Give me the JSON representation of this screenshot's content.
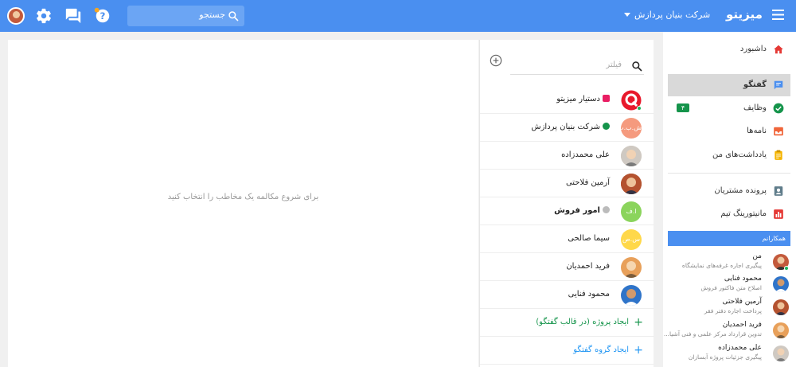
{
  "topbar": {
    "brand": "میزیتو",
    "company": "شرکت بنیان پردازش",
    "search_placeholder": "جستجو"
  },
  "sidebar": {
    "items": [
      {
        "label": "داشبورد",
        "icon": "home-icon",
        "color": "#e53935"
      },
      {
        "label": "گفتگو",
        "icon": "chat-icon",
        "color": "#4a8ff0",
        "active": true
      },
      {
        "label": "وظایف",
        "icon": "check-circle-icon",
        "color": "#15944b",
        "badge": "۴"
      },
      {
        "label": "نامه‌ها",
        "icon": "inbox-icon",
        "color": "#f0653a"
      },
      {
        "label": "یادداشت‌های من",
        "icon": "clipboard-icon",
        "color": "#f5b400"
      },
      {
        "label": "پرونده مشتریان",
        "icon": "contact-icon",
        "color": "#607d8b"
      },
      {
        "label": "مانیتورینگ تیم",
        "icon": "bar-chart-icon",
        "color": "#e53935"
      }
    ],
    "colleagues_header": "همکارانم",
    "colleagues": [
      {
        "name": "من",
        "status": "پیگیری اجاره غرفه‌های نمایشگاه"
      },
      {
        "name": "محمود فنایی",
        "status": "اصلاح متن فاکتور فروش"
      },
      {
        "name": "آرمین فلاحتی",
        "status": "پرداخت اجاره دفتر فقر"
      },
      {
        "name": "فرید احمدیان",
        "status": "تدوین قرارداد مرکز علمی و فنی آشیا..."
      },
      {
        "name": "علی محمدزاده",
        "status": "پیگیری جزئیات پروژه آبسازان"
      }
    ]
  },
  "convlist": {
    "filter_placeholder": "فیلتر",
    "items": [
      {
        "name": "دستیار میزیتو",
        "avatar_text": ""
      },
      {
        "name": "شرکت بنیان پردازش",
        "avatar_text": "ش.ب.پ"
      },
      {
        "name": "علی محمدزاده",
        "avatar_text": ""
      },
      {
        "name": "آرمین فلاحتی",
        "avatar_text": ""
      },
      {
        "name": "امور فروش",
        "avatar_text": "ا.ف"
      },
      {
        "name": "سیما صالحی",
        "avatar_text": "س.ص"
      },
      {
        "name": "فرید احمدیان",
        "avatar_text": ""
      },
      {
        "name": "محمود فنایی",
        "avatar_text": ""
      }
    ],
    "create_project": "ایجاد پروژه (در قالب گفتگو)",
    "create_group": "ایجاد گروه گفتگو"
  },
  "main": {
    "empty_message": "برای شروع مکالمه یک مخاطب را انتخاب کنید"
  },
  "colors": {
    "primary": "#4a8ff0",
    "green": "#15944b",
    "link": "#2196f3"
  }
}
